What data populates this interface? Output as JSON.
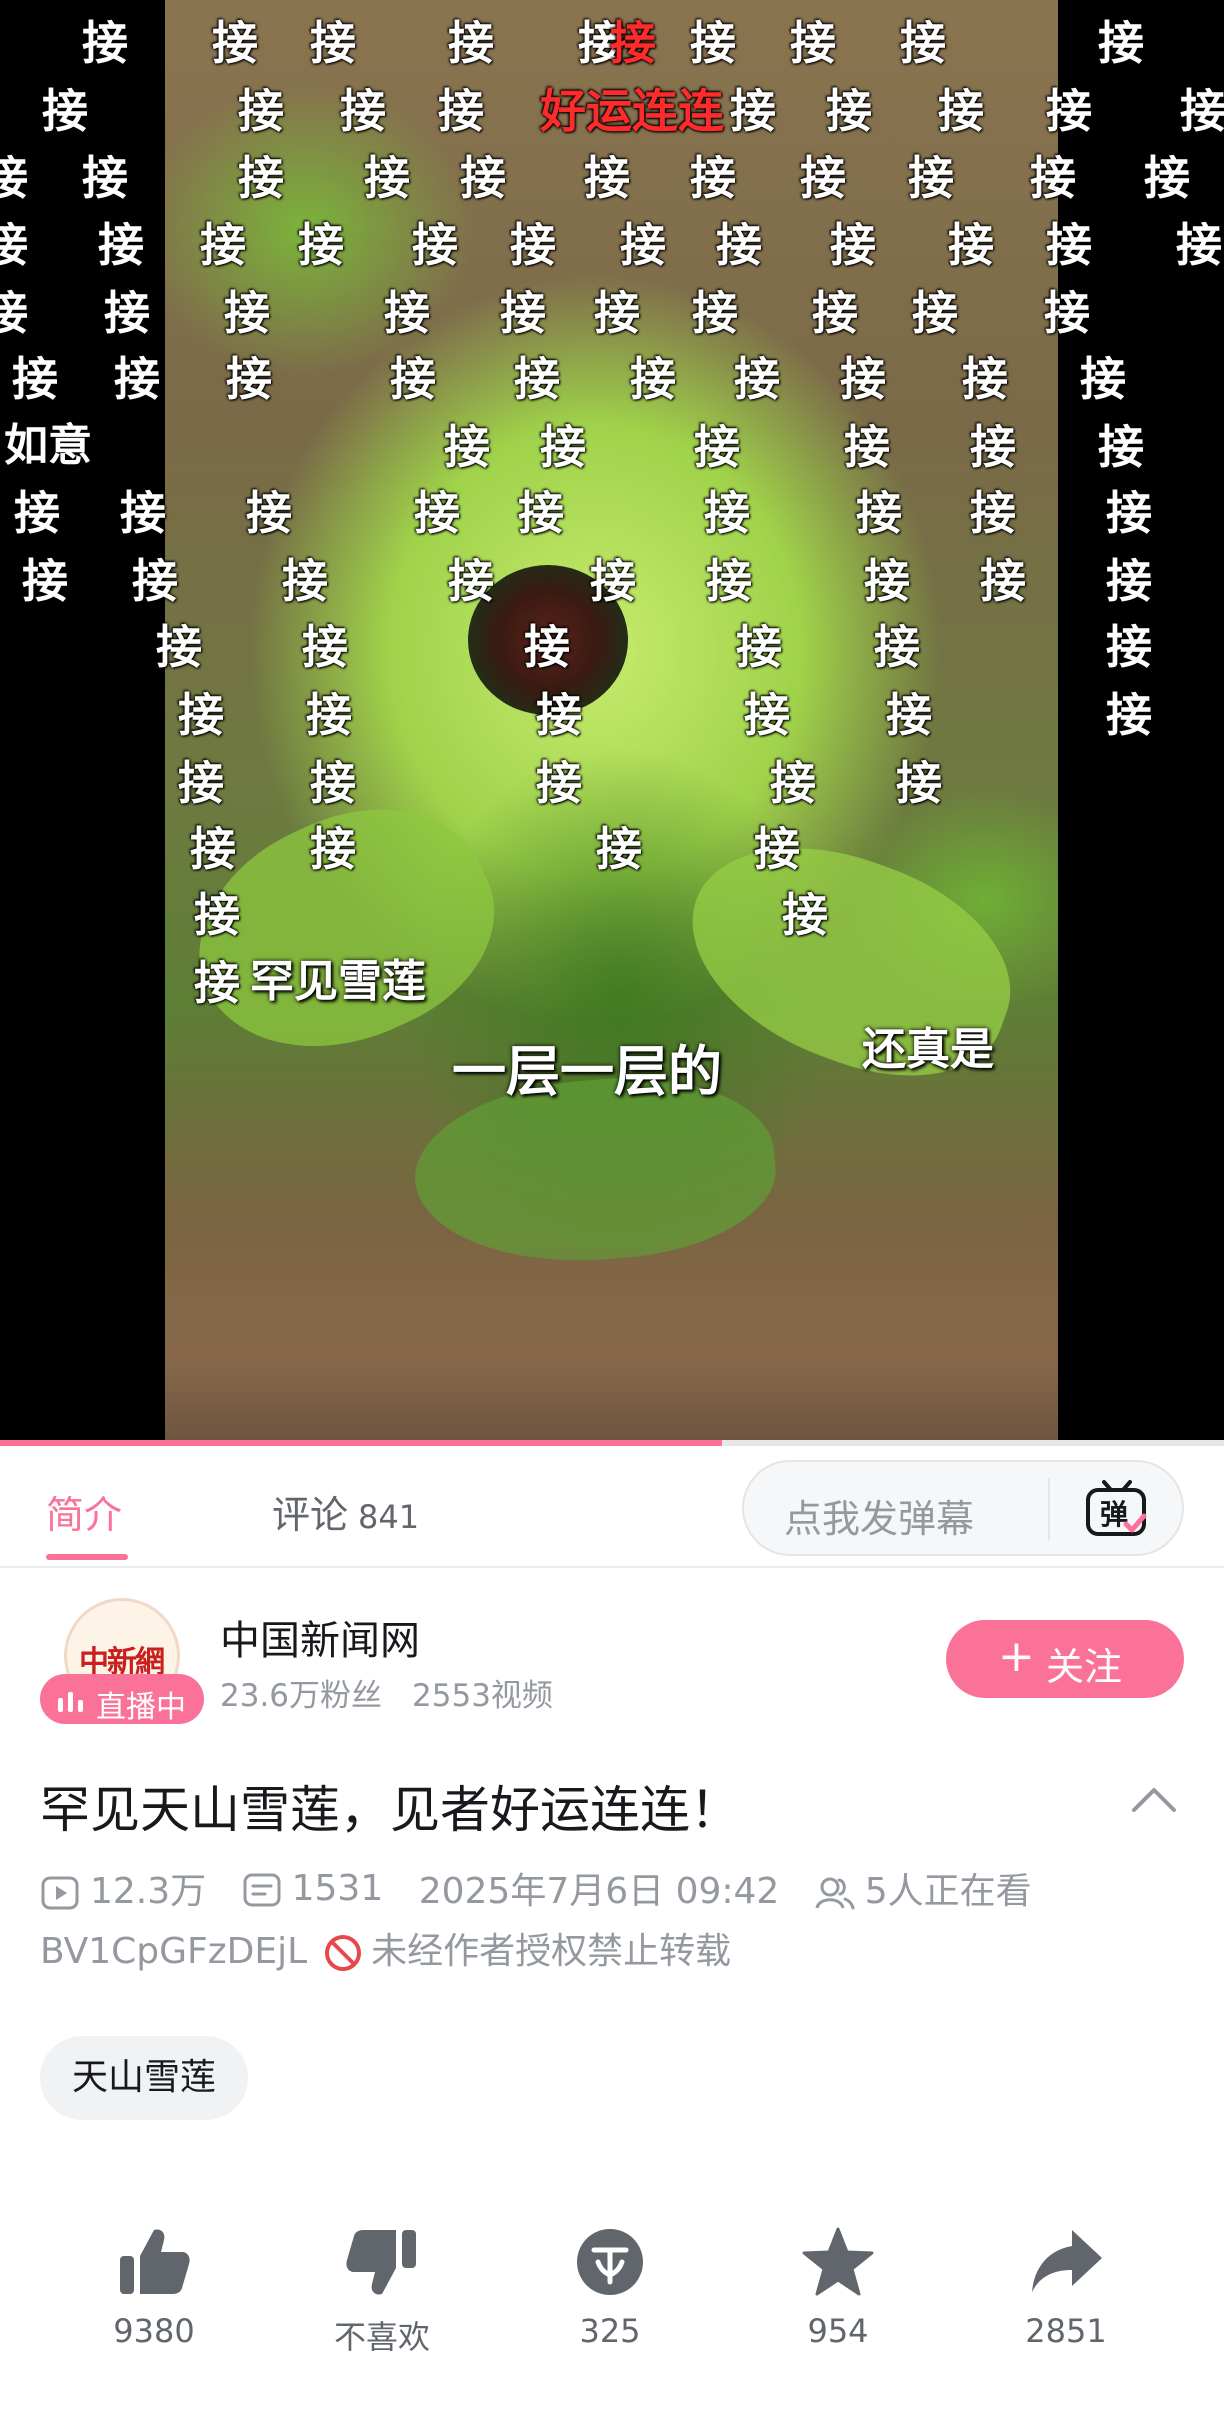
{
  "video": {
    "danmaku_overlay": {
      "rows": [
        [
          "接",
          "接",
          "接",
          "接",
          "接",
          "接",
          "接",
          "接",
          "接"
        ],
        [
          "接",
          "接",
          "接",
          "接",
          "接",
          "接",
          "接",
          "接",
          "接"
        ],
        [
          "接",
          "接",
          "接",
          "接",
          "接",
          "接",
          "接",
          "接",
          "接",
          "接",
          "接"
        ],
        [
          "接",
          "接",
          "接",
          "接",
          "接",
          "接",
          "接",
          "接",
          "接",
          "接",
          "接",
          "接"
        ],
        [
          "接",
          "接",
          "接",
          "接",
          "接",
          "接",
          "接",
          "接",
          "接",
          "接"
        ],
        [
          "接",
          "接",
          "接",
          "接",
          "接",
          "接",
          "接",
          "接",
          "接",
          "接"
        ],
        [
          "接",
          "接",
          "接",
          "接",
          "接",
          "接"
        ],
        [
          "接",
          "接",
          "接",
          "接",
          "接",
          "接",
          "接",
          "接",
          "接"
        ],
        [
          "接",
          "接",
          "接",
          "接",
          "接",
          "接",
          "接",
          "接",
          "接"
        ],
        [
          "接",
          "接",
          "接",
          "接",
          "接",
          "接"
        ],
        [
          "接",
          "接",
          "接",
          "接",
          "接",
          "接"
        ],
        [
          "接",
          "接",
          "接",
          "接",
          "接"
        ],
        [
          "接",
          "接",
          "接",
          "接"
        ],
        [
          "接",
          "接"
        ],
        [
          "接"
        ]
      ],
      "highlight_char": "接",
      "highlight_phrase": "好运连连",
      "phrase_partial": "如意",
      "phrase_rare": "罕见雪莲",
      "phrase_real": "还真是"
    },
    "subtitle": "一层一层的",
    "progress": 0.59
  },
  "tabs": {
    "intro": "简介",
    "comments": "评论",
    "comments_count": "841",
    "danmaku_placeholder": "点我发弹幕",
    "danmaku_icon": "danmaku-toggle-icon"
  },
  "uploader": {
    "avatar_text": "中新網",
    "live_badge": "直播中",
    "name": "中国新闻网",
    "fans": "23.6万粉丝",
    "videos": "2553视频",
    "follow_label": "关注",
    "follow_plus": "+"
  },
  "title": "罕见天山雪莲，见者好运连连！",
  "meta": {
    "views": "12.3万",
    "danmaku_count": "1531",
    "datetime": "2025年7月6日 09:42",
    "watching": "5人正在看",
    "bvid": "BV1CpGFzDEjL",
    "copyright_notice": "未经作者授权禁止转载"
  },
  "tags": [
    "天山雪莲"
  ],
  "actions": {
    "like": "9380",
    "dislike": "不喜欢",
    "coin": "325",
    "favorite": "954",
    "share": "2851"
  },
  "colors": {
    "accent": "#fb7299",
    "muted_text": "#9499a0"
  }
}
